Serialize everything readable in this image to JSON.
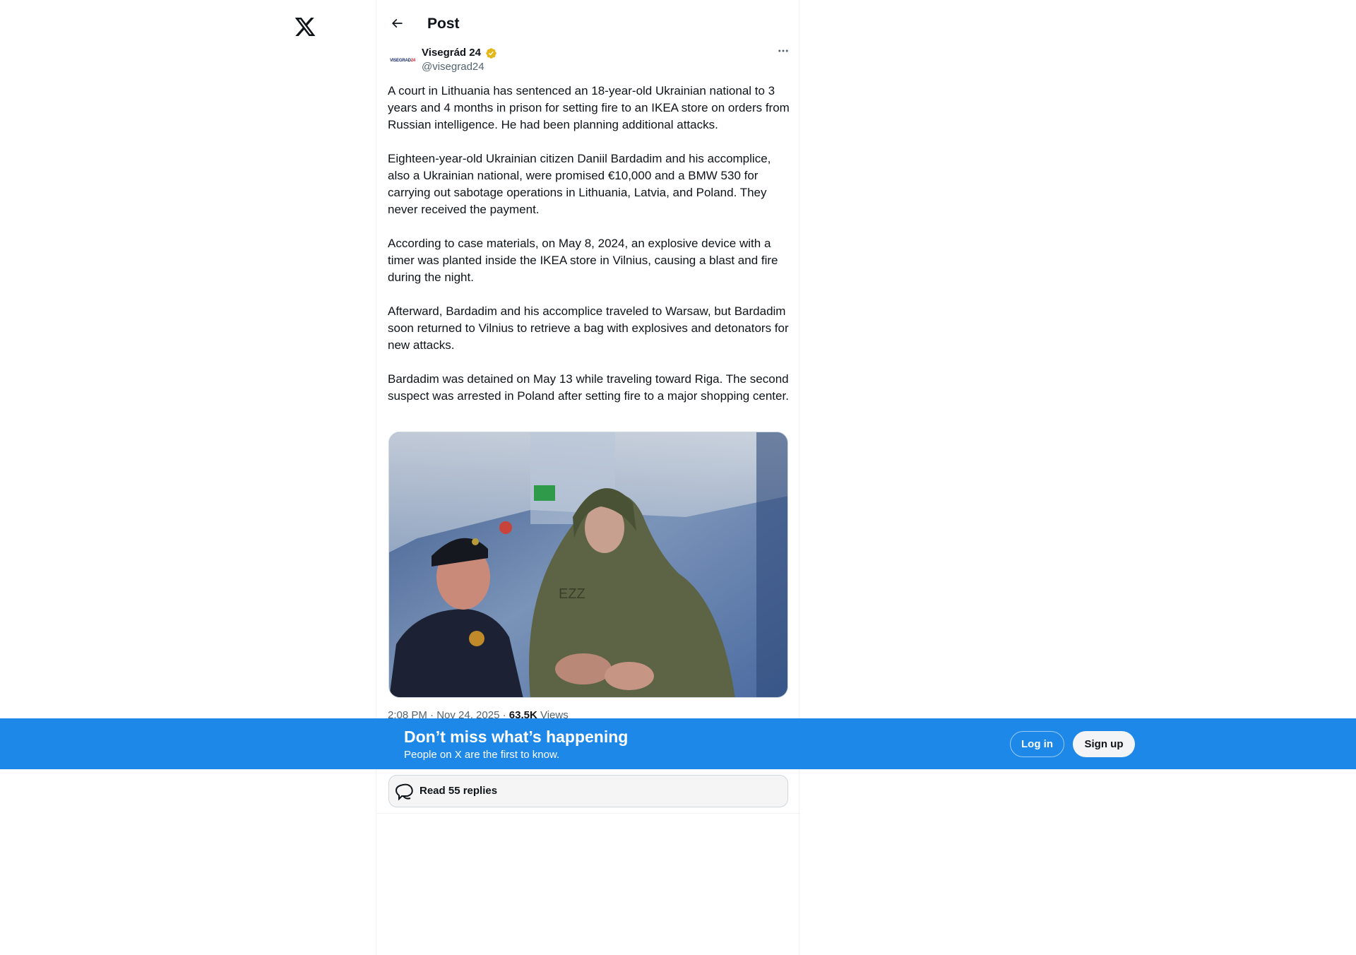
{
  "header": {
    "title": "Post"
  },
  "post": {
    "author": {
      "name": "Visegrád 24",
      "handle": "@visegrad24",
      "avatar_brand": "VISEGRAD",
      "avatar_brand_num": "24"
    },
    "paragraphs": [
      "A court in Lithuania has sentenced an 18-year-old Ukrainian national to 3 years and 4 months in prison for setting fire to an IKEA store on orders from Russian intelligence. He had been planning additional attacks.",
      "Eighteen-year-old Ukrainian citizen Daniil Bardadim and his accomplice, also a Ukrainian national, were promised €10,000 and a BMW 530 for carrying out sabotage operations in Lithuania, Latvia, and Poland. They never received the payment.",
      "According to case materials, on May 8, 2024, an explosive device with a timer was planted inside the IKEA store in Vilnius, causing a blast and fire during the night.",
      "Afterward, Bardadim and his accomplice traveled to Warsaw, but Bardadim soon returned to Vilnius to retrieve a bag with explosives and detonators for new attacks.",
      "Bardadim was detained on May 13 while traveling toward Riga. The second suspect was arrested in Poland after setting fire to a major shopping center."
    ],
    "media_jacket_text": "EZZ",
    "timestamp": "2:08 PM · Nov 24, 2025 · ",
    "views_count": "63.5K",
    "views_label": " Views"
  },
  "banner": {
    "title": "Don’t miss what’s happening",
    "subtitle": "People on X are the first to know.",
    "login_label": "Log in",
    "signup_label": "Sign up"
  },
  "replies": {
    "label": "Read 55 replies"
  },
  "colors": {
    "brand_blue": "#1d88e8",
    "verified_gold": "#e2b719",
    "text_primary": "#0f1419",
    "text_secondary": "#536471"
  },
  "icons": [
    "x-logo-icon",
    "back-arrow-icon",
    "verified-badge-icon",
    "more-options-icon",
    "reply-bubble-icon"
  ]
}
